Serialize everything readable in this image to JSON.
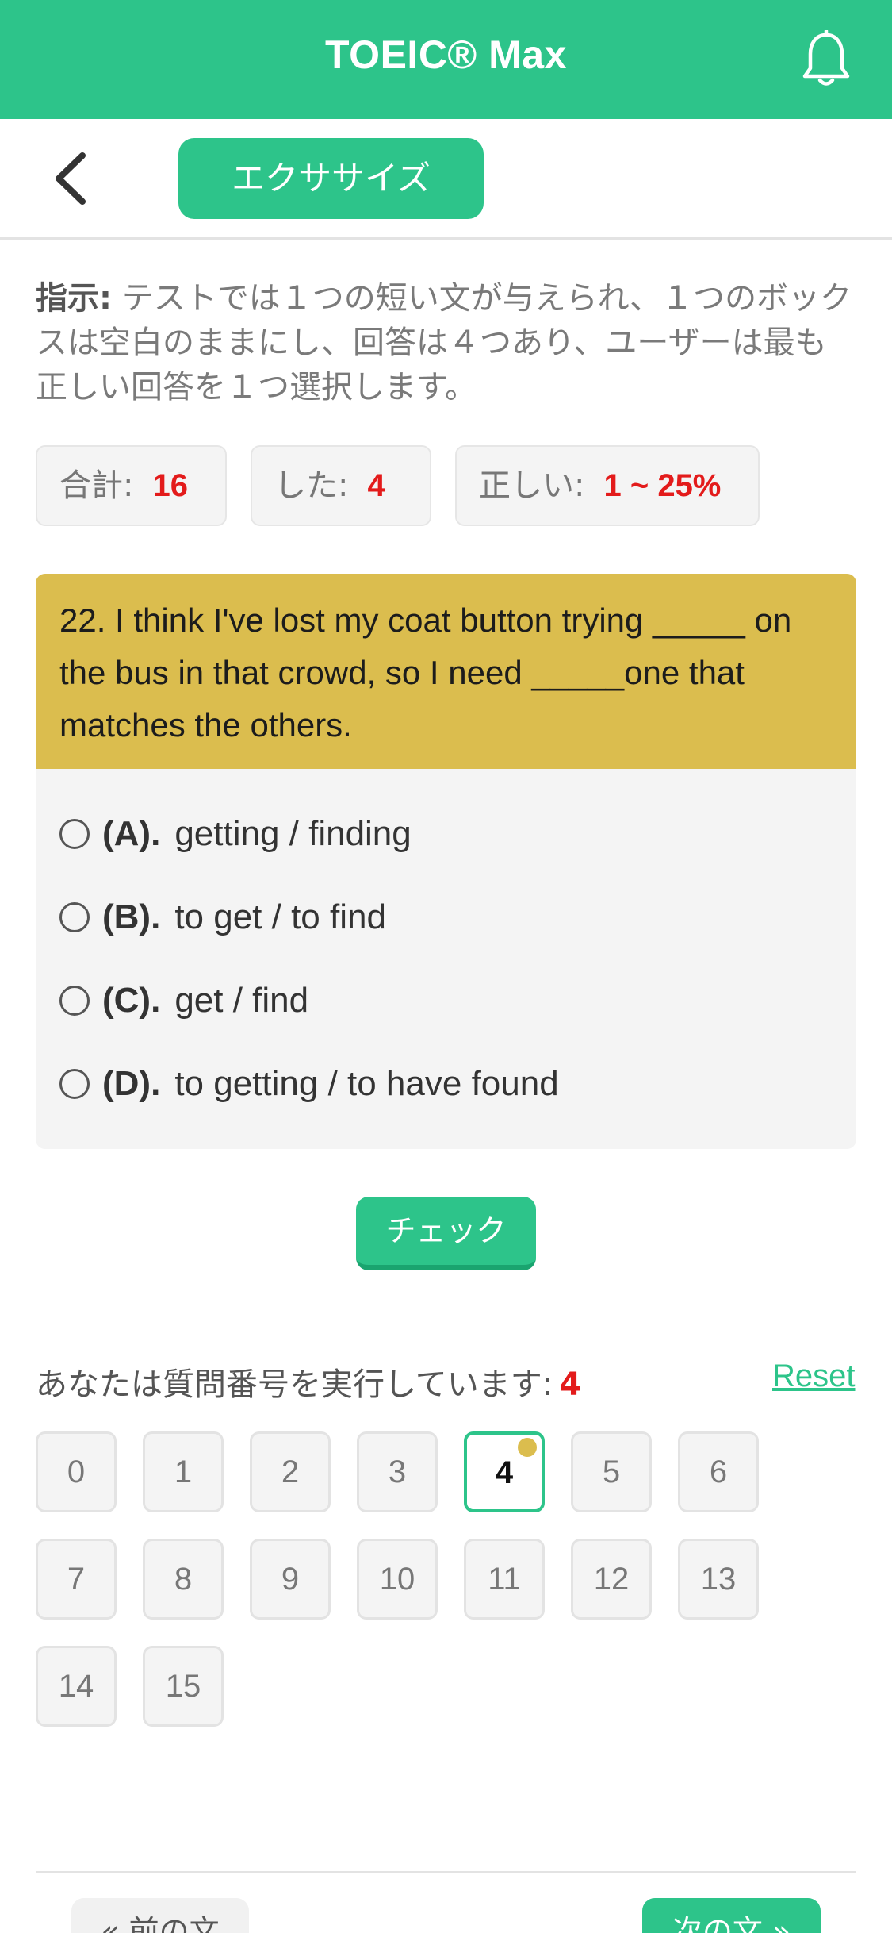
{
  "header": {
    "app_title": "TOEIC® Max",
    "bell_icon": "bell-icon"
  },
  "subheader": {
    "back_icon": "chevron-left-icon",
    "mode_label": "エクササイズ"
  },
  "instruction": {
    "label": "指示:",
    "text": "テストでは１つの短い文が与えられ、１つのボックスは空白のままにし、回答は４つあり、ユーザーは最も正しい回答を１つ選択します。"
  },
  "stats": {
    "total_label": "合計:",
    "total_value": "16",
    "done_label": "した:",
    "done_value": "4",
    "correct_label": "正しい:",
    "correct_value": "1 ~ 25%"
  },
  "question": {
    "text": "22. I think I've lost my coat button trying _____ on the bus in that crowd, so I need _____one that matches the others.",
    "options": [
      {
        "letter": "(A).",
        "text": "getting / finding"
      },
      {
        "letter": "(B).",
        "text": "to get / to find"
      },
      {
        "letter": "(C).",
        "text": "get / find"
      },
      {
        "letter": "(D).",
        "text": "to getting / to have found"
      }
    ]
  },
  "check_label": "チェック",
  "progress": {
    "label": "あなたは質問番号を実行しています:",
    "current": "4",
    "reset_label": "Reset",
    "numbers": [
      "0",
      "1",
      "2",
      "3",
      "4",
      "5",
      "6",
      "7",
      "8",
      "9",
      "10",
      "11",
      "12",
      "13",
      "14",
      "15"
    ],
    "active_index": 4
  },
  "footer": {
    "prev_label": "« 前の文",
    "next_label": "次の文 »"
  },
  "colors": {
    "brand_green": "#2dc48a",
    "question_yellow": "#dbbd4e",
    "stat_red": "#e31b1b"
  }
}
